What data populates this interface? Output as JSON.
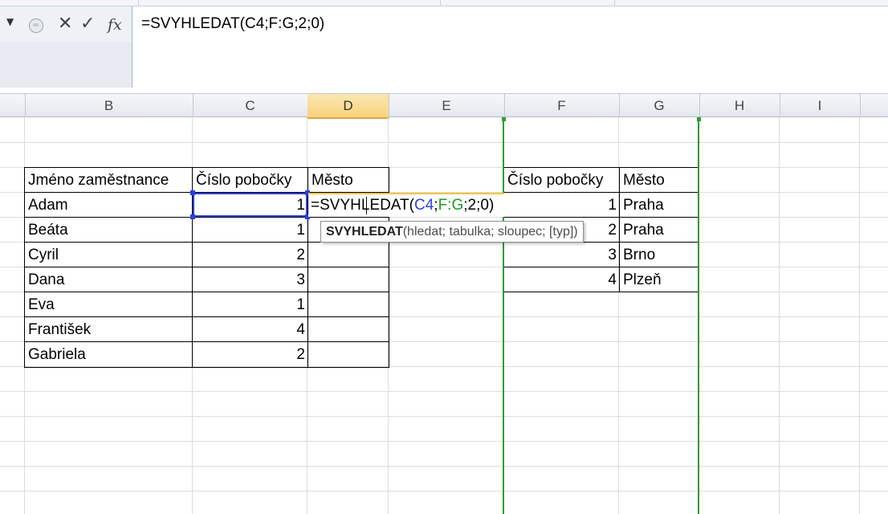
{
  "formula_bar": {
    "cancel_icon": "✕",
    "enter_icon": "✓",
    "fx_icon": "fx",
    "formula": "=SVYHLEDAT(C4;F:G;2;0)"
  },
  "columns": [
    "B",
    "C",
    "D",
    "E",
    "F",
    "G",
    "H",
    "I"
  ],
  "employees_table": {
    "headers": [
      "Jméno zaměstnance",
      "Číslo pobočky",
      "Město"
    ],
    "rows": [
      {
        "name": "Adam",
        "branch": "1"
      },
      {
        "name": "Beáta",
        "branch": "1"
      },
      {
        "name": "Cyril",
        "branch": "2"
      },
      {
        "name": "Dana",
        "branch": "3"
      },
      {
        "name": "Eva",
        "branch": "1"
      },
      {
        "name": "František",
        "branch": "4"
      },
      {
        "name": "Gabriela",
        "branch": "2"
      }
    ]
  },
  "edit_cell": {
    "prefix": "=SVYHLEDAT(",
    "ref1": "C4",
    "sep1": ";",
    "ref2": "F:G",
    "suffix": ";2;0)"
  },
  "tooltip": {
    "function": "SVYHLEDAT",
    "args": "(hledat; tabulka; sloupec; [typ])"
  },
  "lookup_table": {
    "headers": [
      "Číslo pobočky",
      "Město"
    ],
    "rows": [
      {
        "branch": "1",
        "city": "Praha"
      },
      {
        "branch": "2",
        "city": "Praha"
      },
      {
        "branch": "3",
        "city": "Brno"
      },
      {
        "branch": "4",
        "city": "Plzeň"
      }
    ]
  },
  "colors": {
    "ref_blue": "#2c3fe0",
    "ref_green": "#1f9a1f",
    "active_header": "#f7d37c"
  }
}
